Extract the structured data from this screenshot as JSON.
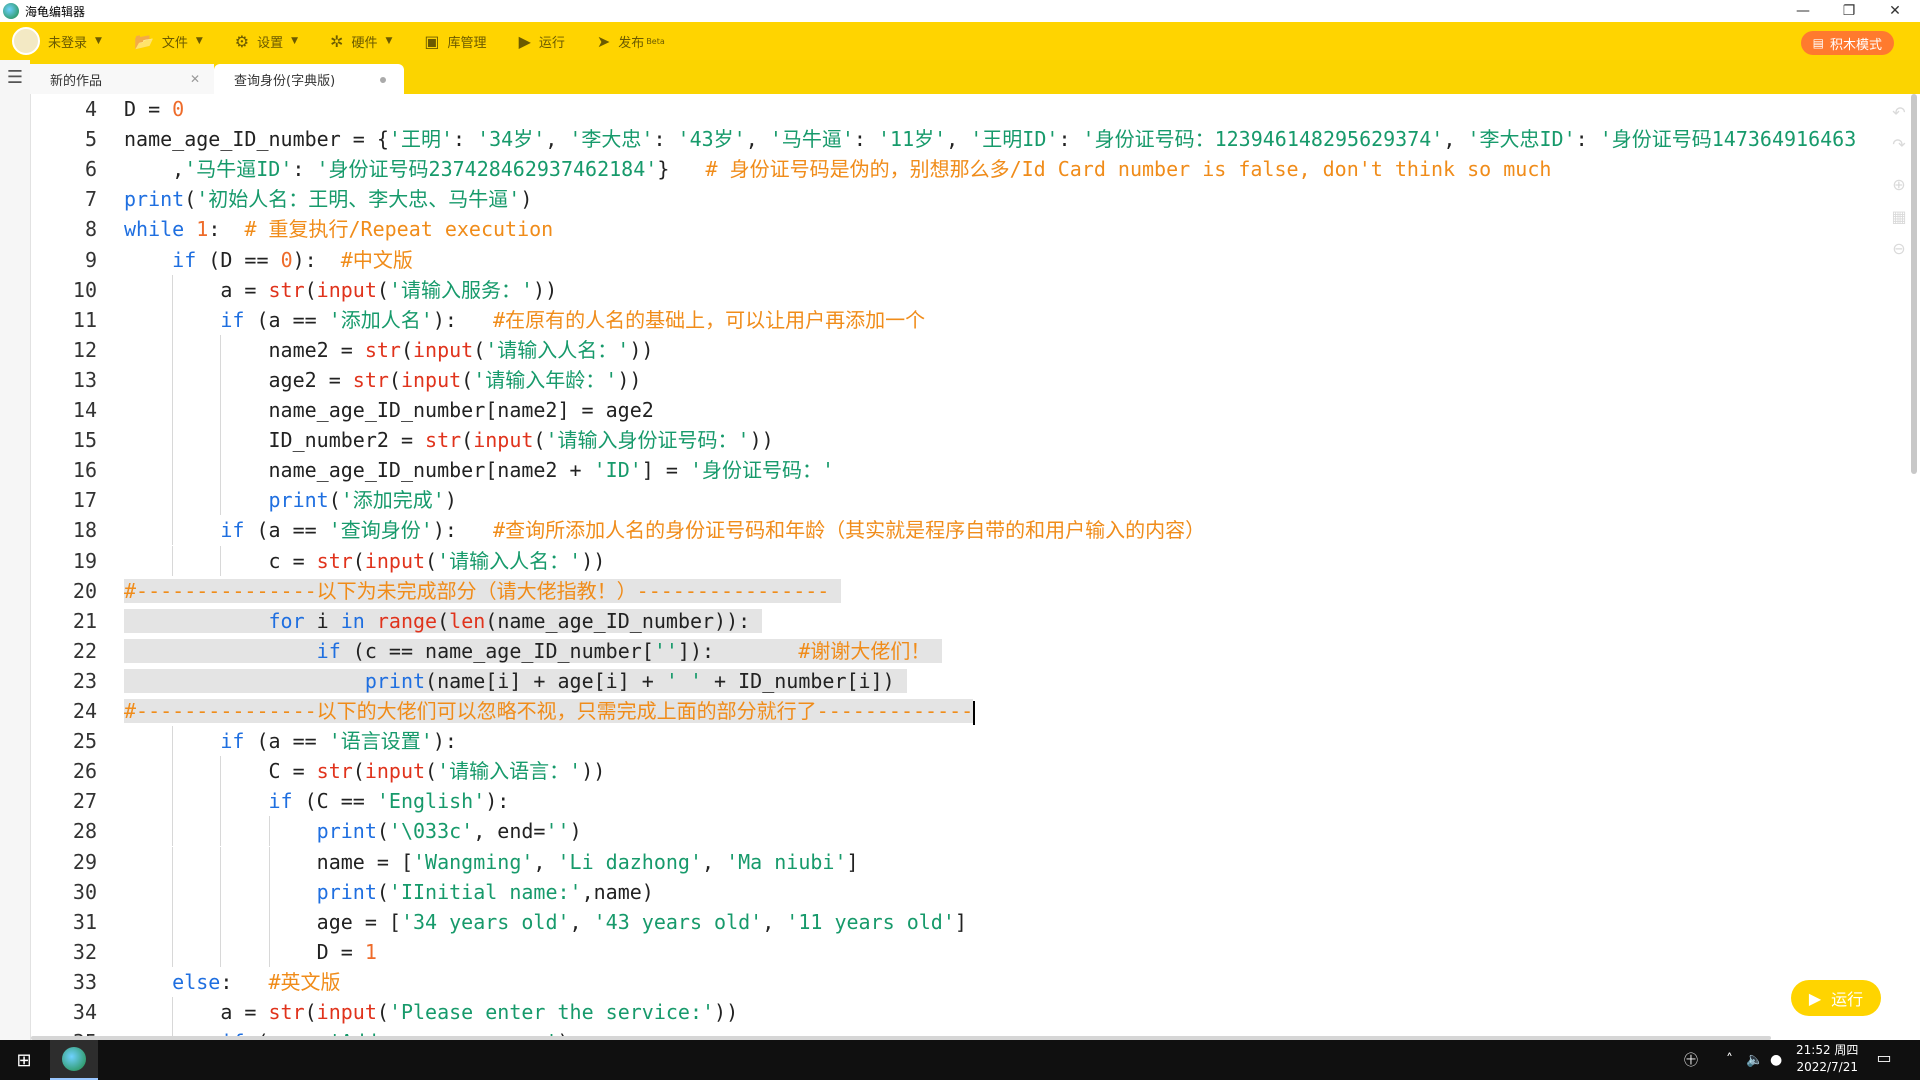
{
  "window": {
    "title": "海龟编辑器",
    "controls": [
      "—",
      "❐",
      "✕"
    ]
  },
  "toolbar": {
    "login_label": "未登录",
    "file_label": "文件",
    "settings_label": "设置",
    "hardware_label": "硬件",
    "library_label": "库管理",
    "run_label": "运行",
    "publish_label": "发布",
    "publish_badge": "Beta",
    "jimu_label": "积木模式"
  },
  "tabs": [
    {
      "label": "新的作品"
    },
    {
      "label": "查询身份(字典版)"
    }
  ],
  "editor": {
    "lines": [
      {
        "n": "4",
        "indent": 0,
        "html": "D = <span class=\"num\">0</span>"
      },
      {
        "n": "5",
        "indent": 0,
        "html": "name_age_ID_number = {<span class=\"st\">'王明'</span>: <span class=\"st\">'34岁'</span>, <span class=\"st\">'李大忠'</span>: <span class=\"st\">'43岁'</span>, <span class=\"st\">'马牛逼'</span>: <span class=\"st\">'11岁'</span>, <span class=\"st\">'王明ID'</span>: <span class=\"st\">'身份证号码：123946148295629374'</span>, <span class=\"st\">'李大忠ID'</span>: <span class=\"st\">'身份证号码147364916463</span>"
      },
      {
        "n": "6",
        "indent": 0,
        "html": "    ,<span class=\"st\">'马牛逼ID'</span>: <span class=\"st\">'身份证号码237428462937462184'</span>}   <span class=\"cm\"># 身份证号码是伪的，别想那么多/Id Card number is false, don't think so much</span>"
      },
      {
        "n": "7",
        "indent": 0,
        "html": "<span class=\"kw\">print</span>(<span class=\"st\">'初始人名：王明、李大忠、马牛逼'</span>)"
      },
      {
        "n": "8",
        "indent": 0,
        "html": "<span class=\"kw\">while</span> <span class=\"num\">1</span>:  <span class=\"cm\"># 重复执行/Repeat execution</span>"
      },
      {
        "n": "9",
        "indent": 1,
        "html": "    <span class=\"kw\">if</span> (D == <span class=\"num\">0</span>):  <span class=\"cm\">#中文版</span>"
      },
      {
        "n": "10",
        "indent": 2,
        "html": "        a = <span class=\"fn\">str</span>(<span class=\"fn\">input</span>(<span class=\"st\">'请输入服务：'</span>))"
      },
      {
        "n": "11",
        "indent": 2,
        "html": "        <span class=\"kw\">if</span> (a == <span class=\"st\">'添加人名'</span>):   <span class=\"cm\">#在原有的人名的基础上，可以让用户再添加一个</span>"
      },
      {
        "n": "12",
        "indent": 3,
        "html": "            name2 = <span class=\"fn\">str</span>(<span class=\"fn\">input</span>(<span class=\"st\">'请输入人名：'</span>))"
      },
      {
        "n": "13",
        "indent": 3,
        "html": "            age2 = <span class=\"fn\">str</span>(<span class=\"fn\">input</span>(<span class=\"st\">'请输入年龄：'</span>))"
      },
      {
        "n": "14",
        "indent": 3,
        "html": "            name_age_ID_number[name2] = age2"
      },
      {
        "n": "15",
        "indent": 3,
        "html": "            ID_number2 = <span class=\"fn\">str</span>(<span class=\"fn\">input</span>(<span class=\"st\">'请输入身份证号码：'</span>))"
      },
      {
        "n": "16",
        "indent": 3,
        "html": "            name_age_ID_number[name2 + <span class=\"st\">'ID'</span>] = <span class=\"st\">'身份证号码：'</span>"
      },
      {
        "n": "17",
        "indent": 3,
        "html": "            <span class=\"kw\">print</span>(<span class=\"st\">'添加完成'</span>)"
      },
      {
        "n": "18",
        "indent": 2,
        "html": "        <span class=\"kw\">if</span> (a == <span class=\"st\">'查询身份'</span>):   <span class=\"cm\">#查询所添加人名的身份证号码和年龄（其实就是程序自带的和用户输入的内容）</span>"
      },
      {
        "n": "19",
        "indent": 3,
        "html": "            c = <span class=\"fn\">str</span>(<span class=\"fn\">input</span>(<span class=\"st\">'请输入人名：'</span>))"
      },
      {
        "n": "20",
        "indent": 0,
        "html": "<span class=\"sel\"><span class=\"cm\">#---------------以下为未完成部分（请大佬指教！）----------------</span> </span>"
      },
      {
        "n": "21",
        "indent": 0,
        "html": "<span class=\"sel\">            <span class=\"kw\">for</span> i <span class=\"kw\">in</span> <span class=\"fn\">range</span>(<span class=\"fn\">len</span>(name_age_ID_number)): </span>"
      },
      {
        "n": "22",
        "indent": 0,
        "html": "<span class=\"sel\">                <span class=\"kw\">if</span> (c == name_age_ID_number[<span class=\"st\">''</span>]):       <span class=\"cm\">#谢谢大佬们！</span> </span>"
      },
      {
        "n": "23",
        "indent": 0,
        "html": "<span class=\"sel\">                    <span class=\"kw\">print</span>(name[i] + age[i] + <span class=\"st\">' '</span> + ID_number[i]) </span>"
      },
      {
        "n": "24",
        "indent": 0,
        "html": "<span class=\"sel\"><span class=\"cm\">#---------------以下的大佬们可以忽略不视，只需完成上面的部分就行了-------------</span></span><span class=\"cursor\"></span>"
      },
      {
        "n": "25",
        "indent": 2,
        "html": "        <span class=\"kw\">if</span> (a == <span class=\"st\">'语言设置'</span>):"
      },
      {
        "n": "26",
        "indent": 3,
        "html": "            C = <span class=\"fn\">str</span>(<span class=\"fn\">input</span>(<span class=\"st\">'请输入语言：'</span>))"
      },
      {
        "n": "27",
        "indent": 3,
        "html": "            <span class=\"kw\">if</span> (C == <span class=\"st\">'English'</span>):"
      },
      {
        "n": "28",
        "indent": 4,
        "html": "                <span class=\"kw\">print</span>(<span class=\"st\">'\\033c'</span>, end=<span class=\"st\">''</span>)"
      },
      {
        "n": "29",
        "indent": 4,
        "html": "                name = [<span class=\"st\">'Wangming'</span>, <span class=\"st\">'Li dazhong'</span>, <span class=\"st\">'Ma niubi'</span>]"
      },
      {
        "n": "30",
        "indent": 4,
        "html": "                <span class=\"kw\">print</span>(<span class=\"st\">'IInitial name:'</span>,name)"
      },
      {
        "n": "31",
        "indent": 4,
        "html": "                age = [<span class=\"st\">'34 years old'</span>, <span class=\"st\">'43 years old'</span>, <span class=\"st\">'11 years old'</span>]"
      },
      {
        "n": "32",
        "indent": 4,
        "html": "                D = <span class=\"num\">1</span>"
      },
      {
        "n": "33",
        "indent": 1,
        "html": "    <span class=\"kw\">else</span>:   <span class=\"cm\">#英文版</span>"
      },
      {
        "n": "34",
        "indent": 2,
        "html": "        a = <span class=\"fn\">str</span>(<span class=\"fn\">input</span>(<span class=\"st\">'Please enter the service:'</span>))"
      },
      {
        "n": "35",
        "indent": 2,
        "html": "        <span class=\"kw\">if</span> (a == <span class=\"st\">'Add a person name'</span>):"
      }
    ]
  },
  "run_button": {
    "label": "运行"
  },
  "taskbar": {
    "time": "21:52 周四",
    "date": "2022/7/21"
  }
}
